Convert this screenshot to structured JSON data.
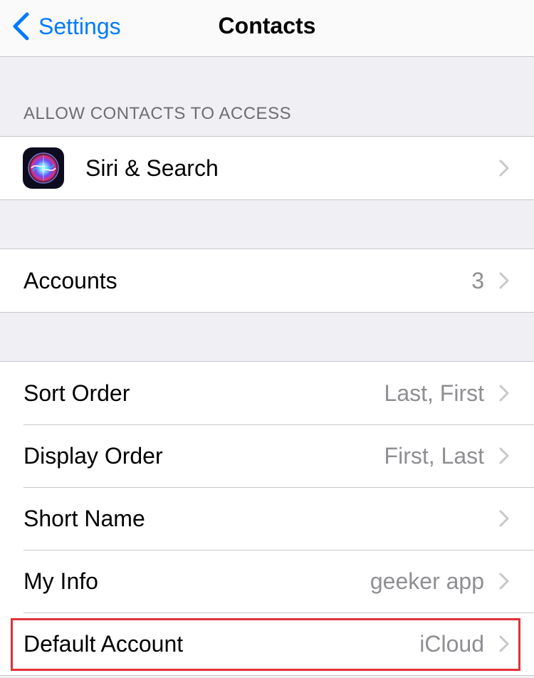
{
  "navbar": {
    "back_label": "Settings",
    "title": "Contacts",
    "accent_color": "#007aff"
  },
  "section_access": {
    "header": "ALLOW CONTACTS TO ACCESS",
    "items": [
      {
        "label": "Siri & Search",
        "icon": "siri-icon"
      }
    ]
  },
  "section_accounts": {
    "items": [
      {
        "label": "Accounts",
        "value": "3"
      }
    ]
  },
  "section_display": {
    "items": [
      {
        "label": "Sort Order",
        "value": "Last, First"
      },
      {
        "label": "Display Order",
        "value": "First, Last"
      },
      {
        "label": "Short Name",
        "value": ""
      },
      {
        "label": "My Info",
        "value": "geeker app"
      },
      {
        "label": "Default Account",
        "value": "iCloud"
      }
    ]
  },
  "annotation": {
    "highlight_color": "#e0323a"
  }
}
